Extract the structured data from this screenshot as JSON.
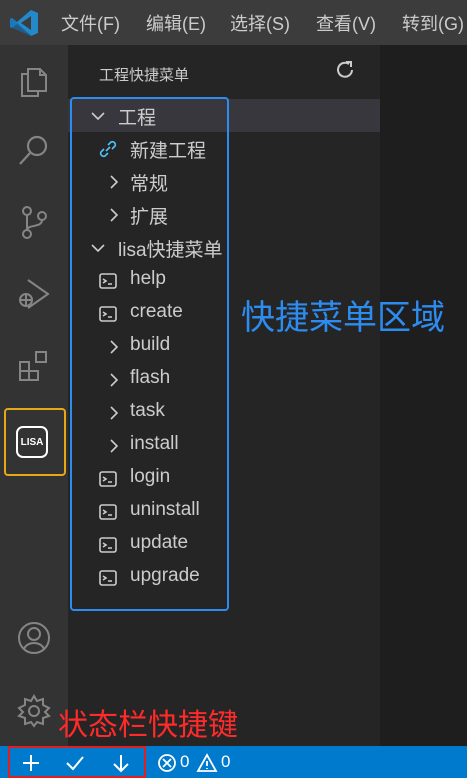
{
  "menu": [
    "文件(F)",
    "编辑(E)",
    "选择(S)",
    "查看(V)",
    "转到(G)"
  ],
  "sidebar": {
    "title": "工程快捷菜单",
    "tree": [
      {
        "label": "工程",
        "kind": "chevron-down-icon",
        "selected": true
      },
      {
        "label": "新建工程",
        "kind": "link-icon"
      },
      {
        "label": "常规",
        "kind": "chevron-right-icon"
      },
      {
        "label": "扩展",
        "kind": "chevron-right-icon"
      },
      {
        "label": "lisa快捷菜单",
        "kind": "chevron-down-icon"
      },
      {
        "label": "help",
        "kind": "terminal-icon"
      },
      {
        "label": "create",
        "kind": "terminal-icon"
      },
      {
        "label": "build",
        "kind": "chevron-right-icon"
      },
      {
        "label": "flash",
        "kind": "chevron-right-icon"
      },
      {
        "label": "task",
        "kind": "chevron-right-icon"
      },
      {
        "label": "install",
        "kind": "chevron-right-icon"
      },
      {
        "label": "login",
        "kind": "terminal-icon"
      },
      {
        "label": "uninstall",
        "kind": "terminal-icon"
      },
      {
        "label": "update",
        "kind": "terminal-icon"
      },
      {
        "label": "upgrade",
        "kind": "terminal-icon"
      }
    ]
  },
  "activity": {
    "lisa_label": "LISA"
  },
  "annotations": {
    "menu_area": "快捷菜单区域",
    "status_area": "状态栏快捷键"
  },
  "status": {
    "errors": "0",
    "warnings": "0"
  },
  "colors": {
    "accent": "#007acc",
    "annotation_blue": "#2d8cf0",
    "annotation_red": "#ff2a2a",
    "highlight": "#e6a817"
  }
}
